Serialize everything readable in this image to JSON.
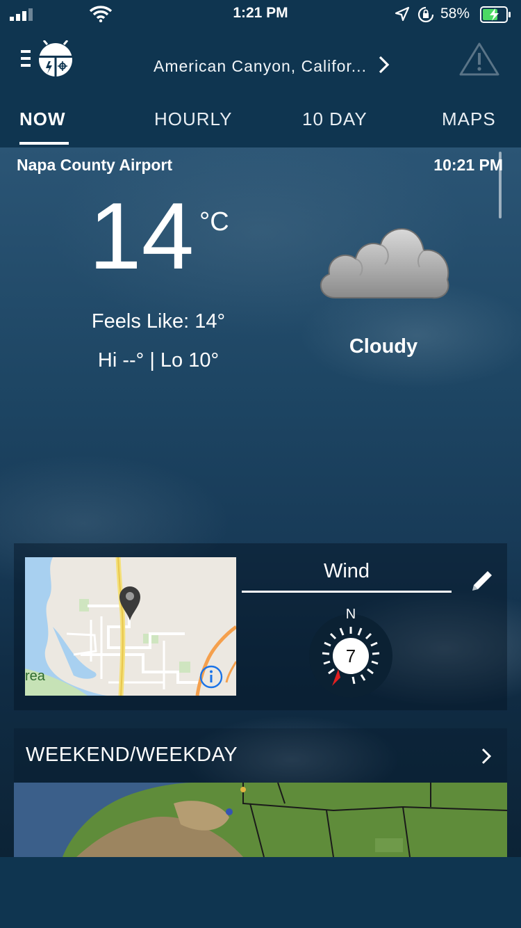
{
  "status_bar": {
    "time": "1:21 PM",
    "battery_percent": "58%",
    "icons": [
      "signal-icon",
      "wifi-icon",
      "location-arrow-icon",
      "rotation-lock-icon",
      "battery-charging-icon"
    ]
  },
  "header": {
    "location": "American Canyon, Califor...",
    "icons": [
      "weatherbug-menu-icon",
      "chevron-right-icon",
      "alert-triangle-icon"
    ]
  },
  "tabs": [
    {
      "label": "NOW",
      "active": true
    },
    {
      "label": "HOURLY",
      "active": false
    },
    {
      "label": "10 DAY",
      "active": false
    },
    {
      "label": "MAPS",
      "active": false
    }
  ],
  "current": {
    "station": "Napa County Airport",
    "observed_time": "10:21 PM",
    "temperature": "14",
    "unit": "°C",
    "feels_like": "Feels Like: 14°",
    "hi_lo": "Hi --° | Lo 10°",
    "condition": "Cloudy",
    "condition_icon": "cloud-icon"
  },
  "wind_card": {
    "map_label": "rea",
    "title": "Wind",
    "compass_north": "N",
    "speed": "7",
    "icons": [
      "map-pin-icon",
      "info-icon",
      "pencil-icon",
      "compass-arrow-icon"
    ]
  },
  "weekend": {
    "label": "WEEKEND/WEEKDAY",
    "icon": "chevron-right-icon"
  },
  "colors": {
    "header_bg": "#0f3550",
    "sky_top": "#2b5575",
    "sky_bottom": "#0c2336",
    "battery_green": "#4cd964",
    "compass_arrow": "#e02020"
  }
}
